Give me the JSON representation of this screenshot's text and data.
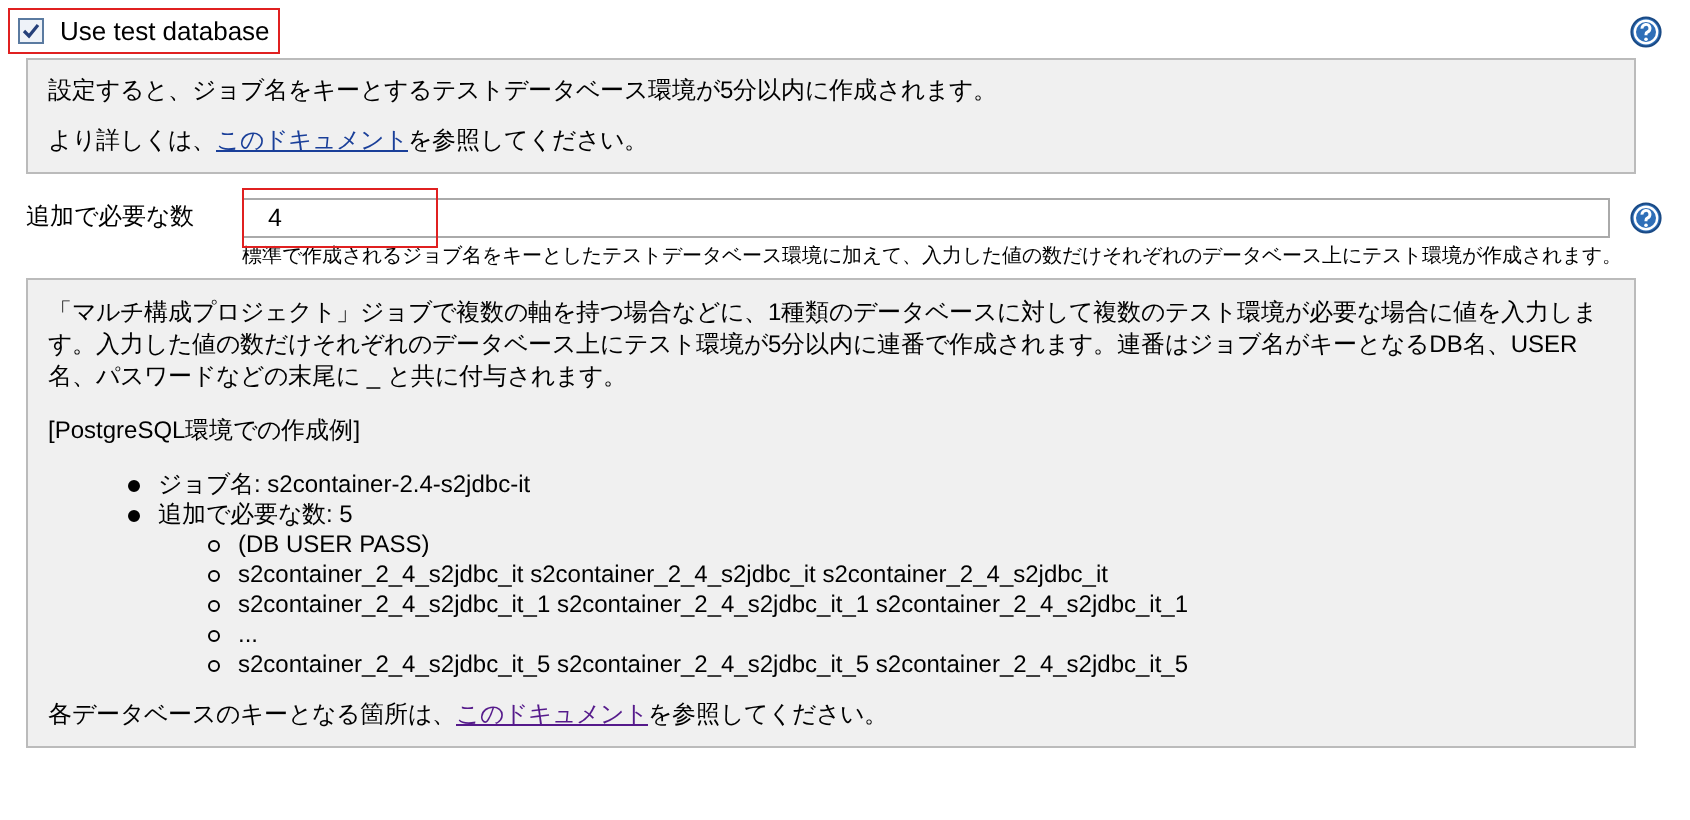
{
  "use_test_database": {
    "label": "Use test database",
    "checked": true,
    "highlighted": true
  },
  "help1": {
    "paragraphs": [
      {
        "before": "設定すると、ジョブ名をキーとするテストデータベース環境が5分以内に作成されます。"
      },
      {
        "before": "より詳しくは、",
        "link": "このドキュメント",
        "visited": false,
        "after": "を参照してください。"
      }
    ]
  },
  "additional_count": {
    "label": "追加で必要な数",
    "value": "4",
    "highlighted": true,
    "hint": "標準で作成されるジョブ名をキーとしたテストデータベース環境に加えて、入力した値の数だけそれぞれのデータベース上にテスト環境が作成されます。"
  },
  "help2": {
    "intro": "「マルチ構成プロジェクト」ジョブで複数の軸を持つ場合などに、1種類のデータベースに対して複数のテスト環境が必要な場合に値を入力します。入力した値の数だけそれぞれのデータベース上にテスト環境が5分以内に連番で作成されます。連番はジョブ名がキーとなるDB名、USER名、パスワードなどの末尾に _ と共に付与されます。",
    "example_title": "[PostgreSQL環境での作成例]",
    "items": [
      {
        "text": "ジョブ名: s2container-2.4-s2jdbc-it"
      },
      {
        "text": "追加で必要な数: 5",
        "children": [
          {
            "text": "(DB USER PASS)"
          },
          {
            "text": "s2container_2_4_s2jdbc_it s2container_2_4_s2jdbc_it s2container_2_4_s2jdbc_it"
          },
          {
            "text": "s2container_2_4_s2jdbc_it_1 s2container_2_4_s2jdbc_it_1 s2container_2_4_s2jdbc_it_1"
          },
          {
            "text": "..."
          },
          {
            "text": "s2container_2_4_s2jdbc_it_5 s2container_2_4_s2jdbc_it_5 s2container_2_4_s2jdbc_it_5"
          }
        ]
      }
    ],
    "footer": {
      "before": "各データベースのキーとなる箇所は、",
      "link": "このドキュメント",
      "visited": true,
      "after": "を参照してください。"
    }
  }
}
